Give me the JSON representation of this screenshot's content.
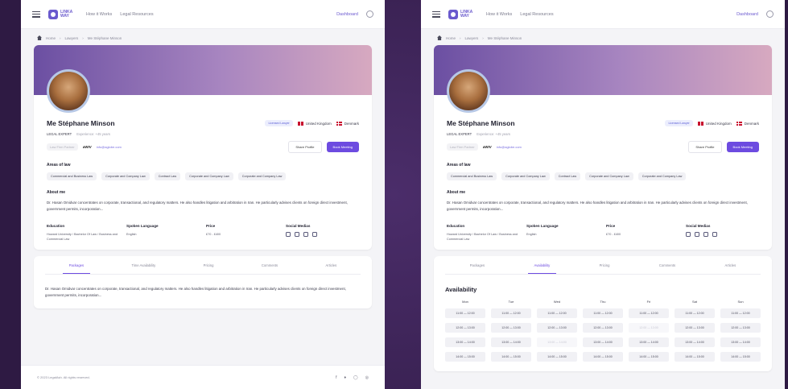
{
  "nav": {
    "logo_text": "LINKA WAY",
    "links": [
      "How it Works",
      "Legal Resources"
    ],
    "dashboard": "Dashboard"
  },
  "breadcrumb": [
    "Home",
    "Lawyers",
    "Me Stéphane Minson"
  ],
  "profile": {
    "name": "Me Stéphane Minson",
    "badge": "Licensed Lawyer",
    "countries": [
      "United Kingdom",
      "Denmark"
    ],
    "role": "LEGAL EXPERT",
    "experience": "Experience: +45 years",
    "chip": "Law Firm Partner",
    "brand": "aWIV",
    "link": "info@aglobe.com",
    "share": "Share Profile",
    "book": "Book Meeting"
  },
  "areas": {
    "title": "Areas of law",
    "items": [
      "Commercial and Business Law",
      "Corporate and Company Law",
      "Contract Law",
      "Corporate and Company Law",
      "Corporate and Company Law"
    ]
  },
  "about": {
    "title": "About me",
    "text": "Dr. Hasan Omidvar concentrates on corporate, transactional, and regulatory matters. He also handles litigation and arbitration in Iran. He particularly advises clients on foreign direct investment, government permits, incorporation..."
  },
  "details": {
    "education_h": "Education",
    "education_v": "Howard University / Bachelor Of Law / Business and Commercial Law",
    "language_h": "Spoken Language",
    "language_v": "English",
    "price_h": "Price",
    "price_v": "£70 - £400",
    "social_h": "Social Medias"
  },
  "tabs": [
    "Packages",
    "Time Availability",
    "Pricing",
    "Comments",
    "Articles"
  ],
  "tab_body": "Dr. Hasan Omidvar concentrates on corporate, transactional, and regulatory matters. He also handles litigation and arbitration in Iran. He particularly advises clients on foreign direct investment, government permits, incorporation...",
  "tabs_right": [
    "Packages",
    "Availability",
    "Pricing",
    "Comments",
    "Articles"
  ],
  "footer": "© 2023 LegalAsh. All rights reserved.",
  "availability": {
    "title": "Availability",
    "days": [
      "Mon",
      "Tue",
      "Wed",
      "Thu",
      "Fri",
      "Sat",
      "Sun"
    ],
    "rows": [
      [
        "11:00 — 12:00",
        "11:00 — 12:00",
        "11:00 — 12:00",
        "11:00 — 12:00",
        "11:00 — 12:00",
        "11:00 — 12:00",
        "11:00 — 12:00"
      ],
      [
        "12:00 — 13:00",
        "12:00 — 13:00",
        "12:00 — 13:00",
        "12:00 — 13:00",
        "12:00 — 13:00",
        "12:00 — 13:00",
        "12:00 — 13:00"
      ],
      [
        "13:00 — 14:00",
        "13:00 — 14:00",
        "13:00 — 14:00",
        "13:00 — 14:00",
        "13:00 — 14:00",
        "13:00 — 14:00",
        "13:00 — 14:00"
      ],
      [
        "14:00 — 15:00",
        "14:00 — 15:00",
        "14:00 — 15:00",
        "14:00 — 15:00",
        "14:00 — 15:00",
        "14:00 — 15:00",
        "14:00 — 15:00"
      ]
    ]
  }
}
